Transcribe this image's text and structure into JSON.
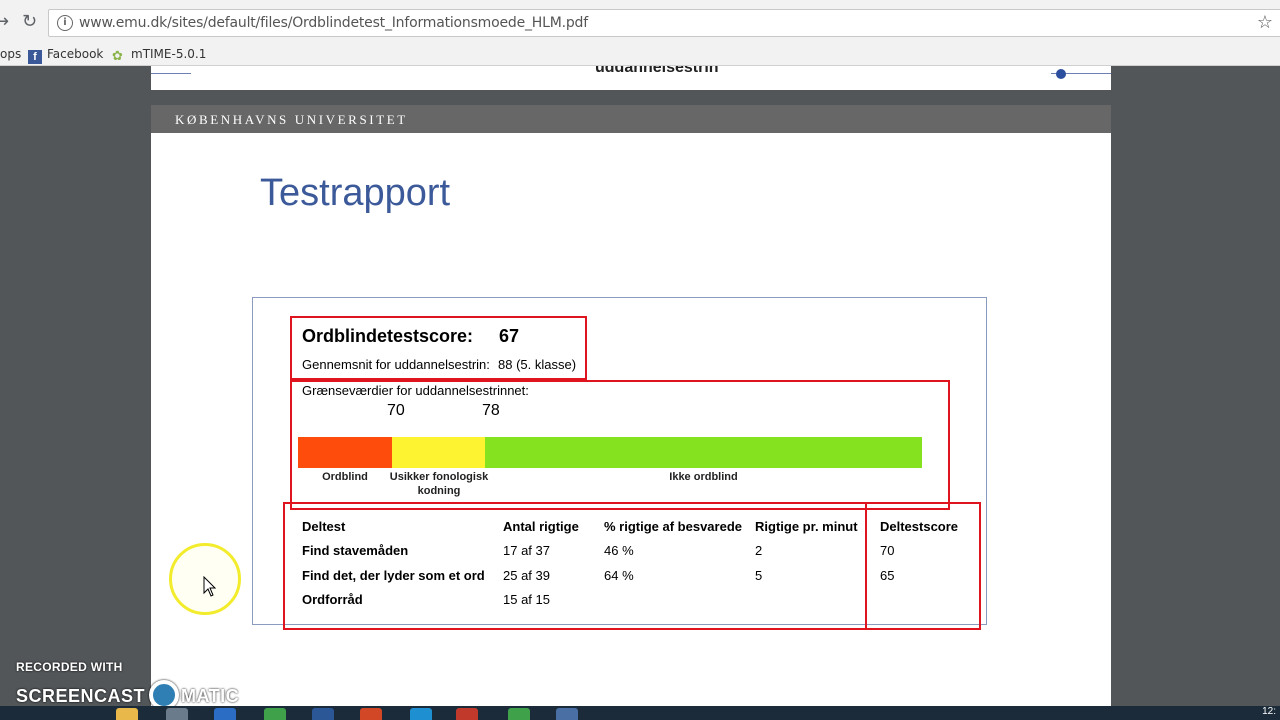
{
  "browser": {
    "url": "www.emu.dk/sites/default/files/Ordblindetest_Informationsmoede_HLM.pdf",
    "back_icon": "back-arrow-icon",
    "reload_icon": "reload-icon",
    "info_icon": "info-icon",
    "star_icon": "bookmark-star-icon",
    "bookmarks": [
      {
        "label": "ops",
        "icon": "apps-icon"
      },
      {
        "label": "Facebook",
        "icon": "facebook-icon"
      },
      {
        "label": "mTIME-5.0.1",
        "icon": "mtime-icon"
      }
    ]
  },
  "pdf": {
    "previous_page_title": "uddannelsestrin",
    "university": "KØBENHAVNS UNIVERSITET",
    "title": "Testrapport",
    "report": {
      "score_label": "Ordblindetestscore:",
      "score_value": "67",
      "average_label": "Gennemsnit for uddannelsestrin:",
      "average_value": "88 (5. klasse)",
      "thresholds_label": "Grænseværdier for uddannelsestrinnet:",
      "threshold_1": "70",
      "threshold_2": "78",
      "scale": [
        {
          "label": "Ordblind",
          "color": "#fe4c0c"
        },
        {
          "label": "Usikker fonologisk kodning",
          "color": "#fdf330"
        },
        {
          "label": "Ikke ordblind",
          "color": "#84e31e"
        }
      ],
      "table": {
        "headers": [
          "Deltest",
          "Antal rigtige",
          "% rigtige af besvarede",
          "Rigtige pr. minut",
          "Deltestscore"
        ],
        "rows": [
          [
            "Find stavemåden",
            "17 af 37",
            "46 %",
            "2",
            "70"
          ],
          [
            "Find det, der lyder som et ord",
            "25 af 39",
            "64 %",
            "5",
            "65"
          ],
          [
            "Ordforråd",
            "15 af 15",
            "",
            "",
            ""
          ]
        ]
      }
    }
  },
  "watermark": {
    "line1": "RECORDED WITH",
    "line2a": "SCREENCAST",
    "line2b": "MATIC"
  },
  "taskbar": {
    "clock": "12:"
  }
}
